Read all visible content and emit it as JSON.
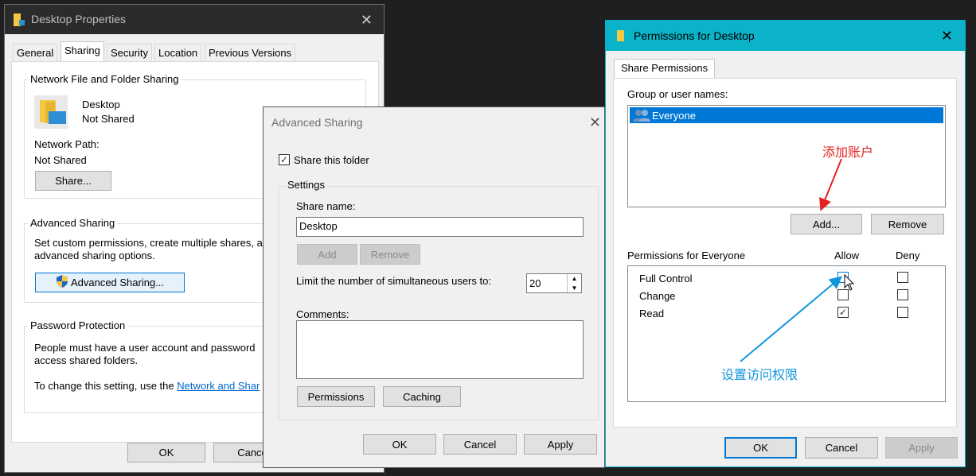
{
  "props": {
    "title": "Desktop Properties",
    "tabs": [
      "General",
      "Sharing",
      "Security",
      "Location",
      "Previous Versions"
    ],
    "nffs_label": "Network File and Folder Sharing",
    "folder_name": "Desktop",
    "folder_status": "Not Shared",
    "network_path_label": "Network Path:",
    "network_path_value": "Not Shared",
    "share_button": "Share...",
    "adv_label": "Advanced Sharing",
    "adv_desc1": "Set custom permissions, create multiple shares, a",
    "adv_desc2": "advanced sharing options.",
    "adv_button": "Advanced Sharing...",
    "pwd_label": "Password Protection",
    "pwd_desc1": "People must have a user account and password",
    "pwd_desc2": "access shared folders.",
    "pwd_change_text": "To change this setting, use the ",
    "pwd_link": "Network and Shar",
    "ok": "OK",
    "cancel": "Cance"
  },
  "advanced": {
    "title": "Advanced Sharing",
    "share_checkbox": "Share this folder",
    "settings_label": "Settings",
    "share_name_label": "Share name:",
    "share_name_value": "Desktop",
    "add": "Add",
    "remove": "Remove",
    "limit_label": "Limit the number of simultaneous users to:",
    "limit_value": "20",
    "comments_label": "Comments:",
    "permissions_button": "Permissions",
    "caching_button": "Caching",
    "ok": "OK",
    "cancel": "Cancel",
    "apply": "Apply"
  },
  "perm": {
    "title": "Permissions for Desktop",
    "tab": "Share Permissions",
    "group_label": "Group or user names:",
    "user": "Everyone",
    "add": "Add...",
    "remove": "Remove",
    "perm_for_label": "Permissions for Everyone",
    "allow": "Allow",
    "deny": "Deny",
    "rows": [
      {
        "name": "Full Control",
        "allow": false,
        "deny": false
      },
      {
        "name": "Change",
        "allow": false,
        "deny": false
      },
      {
        "name": "Read",
        "allow": true,
        "deny": false
      }
    ],
    "ok": "OK",
    "cancel": "Cancel",
    "apply": "Apply"
  },
  "annotations": {
    "add_account": "添加账户",
    "set_permissions": "设置访问权限",
    "add_account_color": "#e52222",
    "set_permissions_color": "#1296db"
  },
  "colors": {
    "selection": "#0078d7",
    "title_active": "#0ab3c9",
    "title_inactive": "#2b2b2b",
    "folder": "#f5c843"
  }
}
